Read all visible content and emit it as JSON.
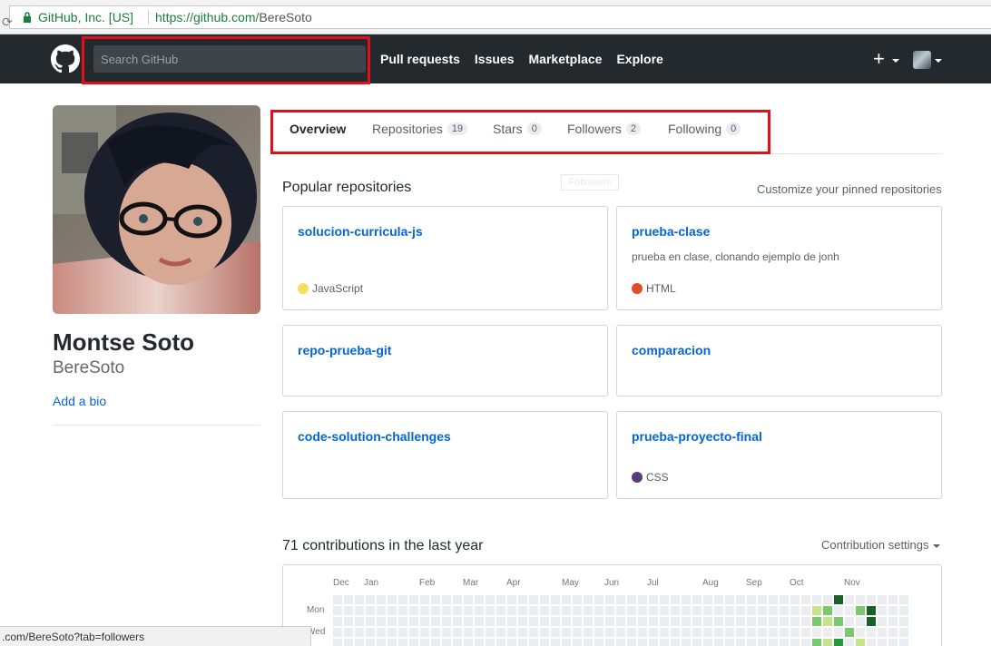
{
  "browser": {
    "secure_label": "GitHub, Inc. [US]",
    "url_host": "https://github.com/",
    "url_path": "BereSoto"
  },
  "header": {
    "search_placeholder": "Search GitHub",
    "nav": [
      "Pull requests",
      "Issues",
      "Marketplace",
      "Explore"
    ],
    "plus_icon": "plus-icon",
    "logo_icon": "github-mark-icon"
  },
  "profile": {
    "fullname": "Montse Soto",
    "username": "BereSoto",
    "add_bio": "Add a bio"
  },
  "tabs": [
    {
      "label": "Overview",
      "count": null,
      "selected": true
    },
    {
      "label": "Repositories",
      "count": "19"
    },
    {
      "label": "Stars",
      "count": "0"
    },
    {
      "label": "Followers",
      "count": "2"
    },
    {
      "label": "Following",
      "count": "0"
    }
  ],
  "tooltip": "Followers",
  "popular": {
    "title": "Popular repositories",
    "customize": "Customize your pinned repositories",
    "repos": [
      {
        "name": "solucion-curricula-js",
        "desc": "",
        "lang": "JavaScript",
        "color": "#f1e05a"
      },
      {
        "name": "prueba-clase",
        "desc": "prueba en clase, clonando ejemplo de jonh",
        "lang": "HTML",
        "color": "#e34c26"
      },
      {
        "name": "repo-prueba-git",
        "desc": "",
        "lang": "",
        "color": ""
      },
      {
        "name": "comparacion",
        "desc": "",
        "lang": "",
        "color": ""
      },
      {
        "name": "code-solution-challenges",
        "desc": "",
        "lang": "",
        "color": ""
      },
      {
        "name": "prueba-proyecto-final",
        "desc": "",
        "lang": "CSS",
        "color": "#563d7c"
      }
    ]
  },
  "contributions": {
    "title": "71 contributions in the last year",
    "settings": "Contribution settings",
    "months": [
      "Dec",
      "Jan",
      "Feb",
      "Mar",
      "Apr",
      "May",
      "Jun",
      "Jul",
      "Aug",
      "Sep",
      "Oct",
      "Nov"
    ],
    "weekdays": [
      "Mon",
      "Wed"
    ],
    "colors": {
      "empty": "#ebedf0",
      "l1": "#c6e48b",
      "l2": "#7bc96f",
      "l3": "#239a3b",
      "l4": "#196127"
    }
  },
  "statusbar": ".com/BereSoto?tab=followers",
  "colors": {
    "header_bg": "#24292e",
    "link": "#0366d6",
    "highlight": "#e0101a"
  }
}
